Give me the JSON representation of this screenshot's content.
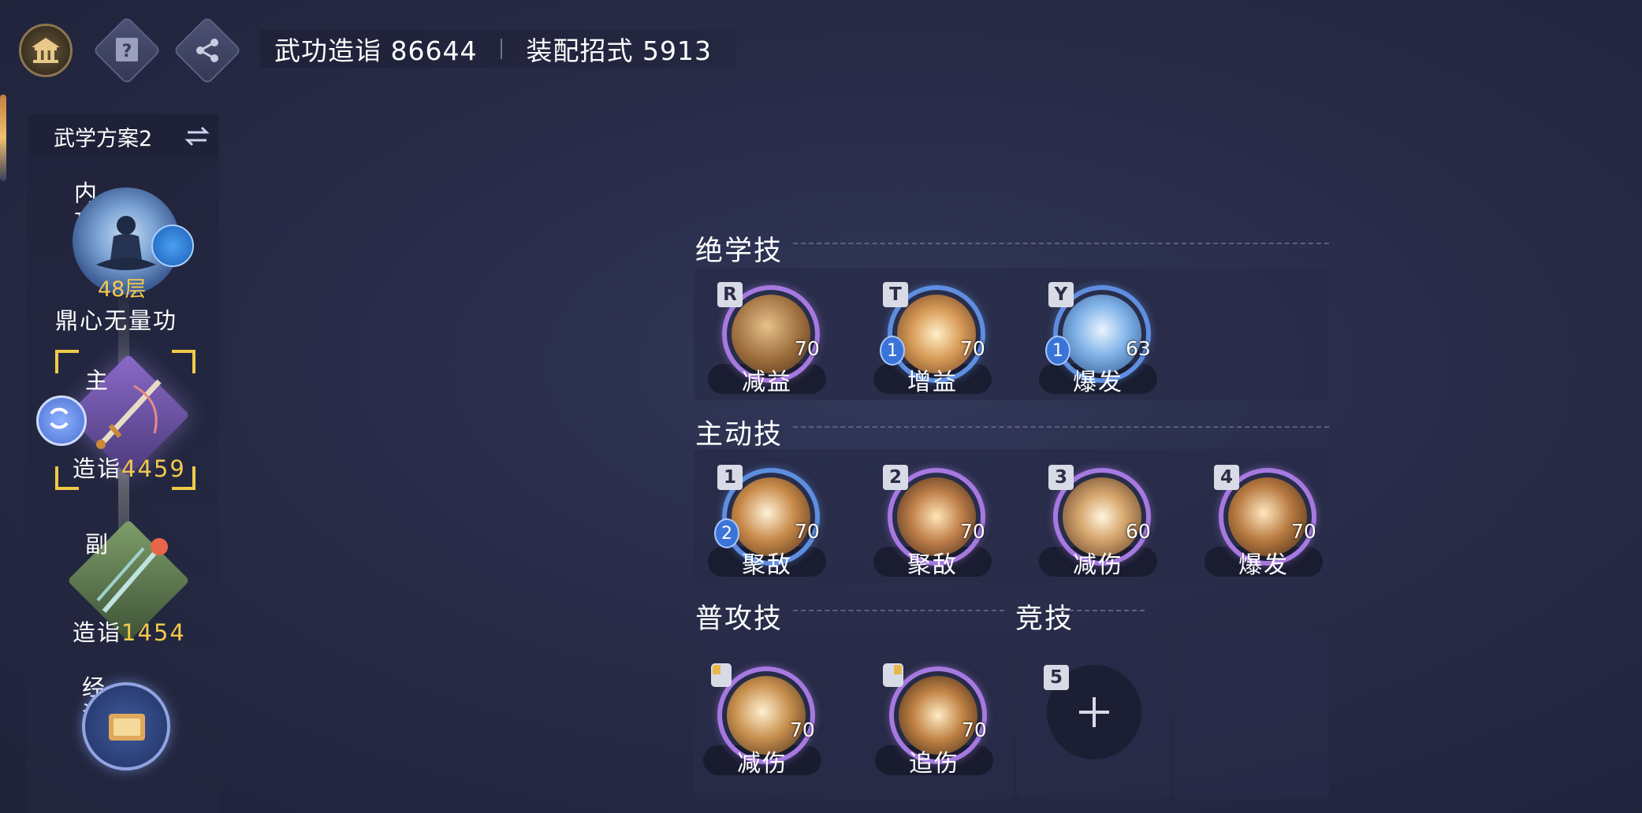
{
  "header": {
    "icons": [
      "home-icon",
      "help-icon",
      "share-icon"
    ],
    "wugong_label": "武功造诣 86644",
    "equip_label": "装配招式 5913"
  },
  "left_panel": {
    "plan_label": "武学方案2",
    "neigong": {
      "char1": "内",
      "char2": "功",
      "level": "48层",
      "name": "鼎心无量功"
    },
    "main_weapon": {
      "char": "主",
      "label": "造诣",
      "value": "4459"
    },
    "sub_weapon": {
      "char": "副",
      "label": "造诣",
      "value": "1454"
    },
    "jingzhu": {
      "char1": "经",
      "char2": "注"
    }
  },
  "sections": {
    "juexue": "绝学技",
    "zhudong": "主动技",
    "pugong": "普攻技",
    "jingji": "竞技"
  },
  "juexue_skills": [
    {
      "key": "R",
      "level": "70",
      "tag": "减益",
      "badge": ""
    },
    {
      "key": "T",
      "level": "70",
      "tag": "增益",
      "badge": "1"
    },
    {
      "key": "Y",
      "level": "63",
      "tag": "爆发",
      "badge": "1"
    }
  ],
  "zhudong_skills": [
    {
      "key": "1",
      "level": "70",
      "tag": "聚敌",
      "badge": "2"
    },
    {
      "key": "2",
      "level": "70",
      "tag": "聚敌",
      "badge": ""
    },
    {
      "key": "3",
      "level": "60",
      "tag": "减伤",
      "badge": ""
    },
    {
      "key": "4",
      "level": "70",
      "tag": "爆发",
      "badge": ""
    }
  ],
  "pugong_skills": [
    {
      "key": "left-mouse",
      "level": "70",
      "tag": "减伤"
    },
    {
      "key": "right-mouse",
      "level": "70",
      "tag": "追伤"
    }
  ],
  "jingji_slot": {
    "key": "5",
    "icon": "plus-icon"
  },
  "colors": {
    "accent_gold": "#f2c94c",
    "orb_purple": "#a679e0",
    "orb_blue": "#5e8ee0"
  }
}
